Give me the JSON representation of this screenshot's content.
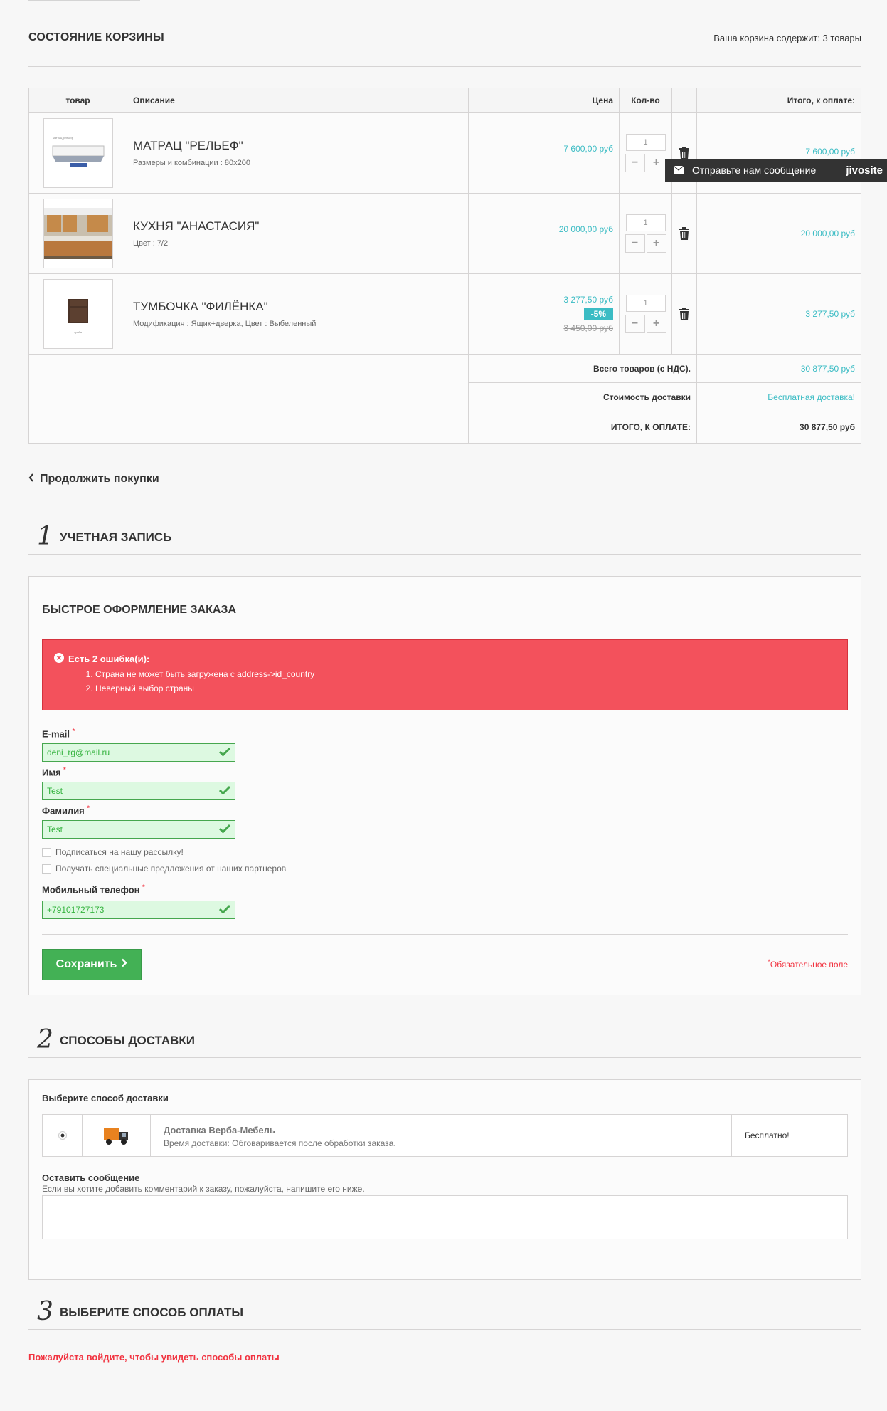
{
  "cart_header": {
    "title": "СОСТОЯНИЕ КОРЗИНЫ",
    "count_text": "Ваша корзина содержит: 3 товары"
  },
  "table": {
    "headers": [
      "товар",
      "Описание",
      "Цена",
      "Кол-во",
      "",
      "Итого, к оплате:"
    ],
    "products": [
      {
        "name": "МАТРАЦ \"РЕЛЬЕФ\"",
        "attrs": "Размеры и комбинации : 80x200",
        "price": "7 600,00 руб",
        "discount": "",
        "old_price": "",
        "qty": "1",
        "total": "7 600,00 руб",
        "image": "mattress-image"
      },
      {
        "name": "КУХНЯ \"АНАСТАСИЯ\"",
        "attrs": "Цвет : 7/2",
        "price": "20 000,00 руб",
        "discount": "",
        "old_price": "",
        "qty": "1",
        "total": "20 000,00 руб",
        "image": "kitchen-image"
      },
      {
        "name": "ТУМБОЧКА \"ФИЛЁНКА\"",
        "attrs": "Модификация : Ящик+дверка, Цвет : Выбеленный",
        "price": "3 277,50 руб",
        "discount": "-5%",
        "old_price": "3 450,00 руб",
        "qty": "1",
        "total": "3 277,50 руб",
        "image": "nightstand-image"
      }
    ],
    "summary": {
      "subtotal_label": "Всего товаров (с НДС).",
      "subtotal_value": "30 877,50 руб",
      "shipping_label": "Стоимость доставки",
      "shipping_value": "Бесплатная доставка!",
      "grand_label": "ИТОГО, К ОПЛАТЕ:",
      "grand_value": "30 877,50 руб"
    }
  },
  "chat_widget": {
    "text": "Отправьте нам сообщение",
    "logo": "jivosite"
  },
  "continue_link": "Продолжить покупки",
  "steps": [
    {
      "num": "1",
      "title": "УЧЕТНАЯ ЗАПИСЬ"
    },
    {
      "num": "2",
      "title": "СПОСОБЫ ДОСТАВКИ"
    },
    {
      "num": "3",
      "title": "ВЫБЕРИТЕ СПОСОБ ОПЛАТЫ"
    }
  ],
  "quick_order": {
    "title": "БЫСТРОЕ ОФОРМЛЕНИЕ ЗАКАЗА",
    "error_title": "Есть 2 ошибка(и):",
    "errors": [
      "Страна не может быть загружена с address->id_country",
      "Неверный выбор страны"
    ],
    "email_label": "E-mail",
    "email_value": "deni_rg@mail.ru",
    "name_label": "Имя",
    "name_value": "Test",
    "surname_label": "Фамилия",
    "surname_value": "Test",
    "newsletter_label": "Подписаться на нашу рассылку!",
    "partners_label": "Получать специальные предложения от наших партнеров",
    "phone_label": "Мобильный телефон",
    "phone_value": "+79101727173",
    "required_mark": "*",
    "save_label": "Сохранить",
    "required_note": "Обязательное поле"
  },
  "delivery": {
    "choose_label": "Выберите способ доставки",
    "carrier_name": "Доставка Верба-Мебель",
    "carrier_time": "Время доставки: Обговаривается после обработки заказа.",
    "carrier_price": "Бесплатно!",
    "message_title": "Оставить сообщение",
    "message_hint": "Если вы хотите добавить комментарий к заказу, пожалуйста, напишите его ниже."
  },
  "payment": {
    "login_note": "Пожалуйста войдите, чтобы увидеть способы оплаты"
  },
  "colors": {
    "accent": "#3bbcc4",
    "error_bg": "#f3515c",
    "success_bg": "#ddf9e1",
    "success_border": "#46a74e",
    "button_green": "#43b155",
    "required_red": "#f13340"
  }
}
